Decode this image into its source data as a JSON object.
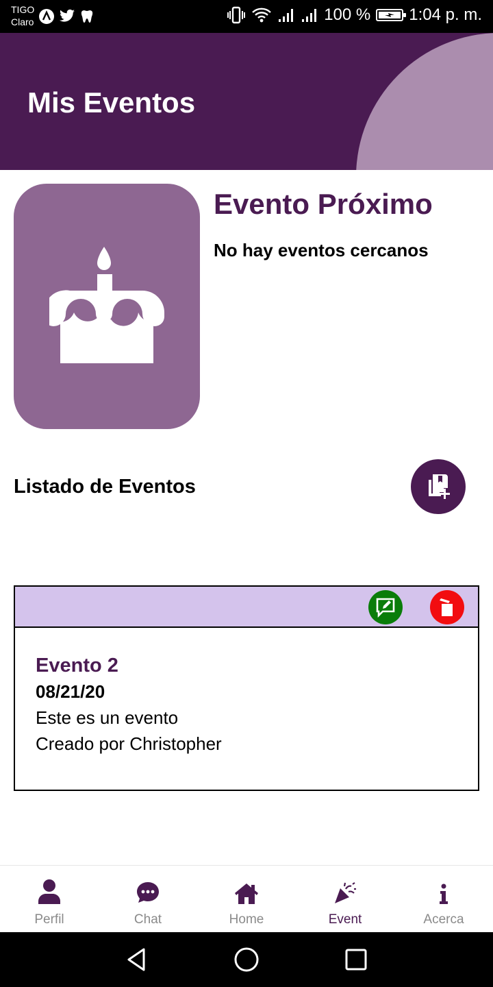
{
  "status": {
    "carrier1": "TIGO",
    "carrier2": "Claro",
    "battery": "100 %",
    "time": "1:04 p. m."
  },
  "header": {
    "title": "Mis Eventos"
  },
  "upcoming": {
    "title": "Evento Próximo",
    "message": "No hay eventos cercanos",
    "icon": "cake-icon"
  },
  "list": {
    "title": "Listado de Eventos",
    "add_icon": "add-event-icon"
  },
  "events": [
    {
      "name": "Evento 2",
      "date": "08/21/20",
      "description": "Este es un evento",
      "creator": "Creado por Christopher"
    }
  ],
  "nav": {
    "items": [
      {
        "label": "Perfil",
        "icon": "person-icon"
      },
      {
        "label": "Chat",
        "icon": "chat-icon"
      },
      {
        "label": "Home",
        "icon": "home-icon"
      },
      {
        "label": "Event",
        "icon": "party-icon"
      },
      {
        "label": "Acerca",
        "icon": "info-icon"
      }
    ],
    "active_index": 3
  },
  "colors": {
    "primary": "#4a1b52",
    "accent_light": "#ab8dae",
    "tile": "#8e6792",
    "card_bar": "#d4c3ec",
    "edit": "#0a7d0a",
    "delete": "#f20d10",
    "inactive": "#8a8a8a"
  }
}
